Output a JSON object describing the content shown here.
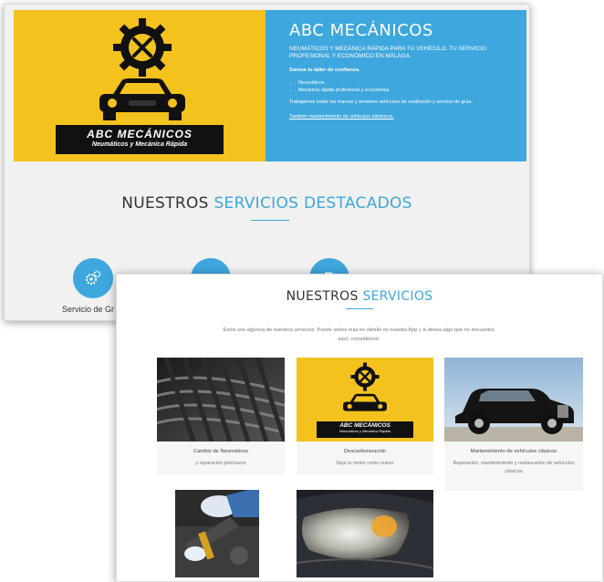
{
  "hero": {
    "logo_name": "ABC MECÁNICOS",
    "logo_tagline": "Neumáticos y Mecánica Rápida",
    "title": "ABC MECÁNICOS",
    "subtitle": "NEUMÁTICOS Y MECÁNICA RÁPIDA PARA TU VEHÍCULO. TU SERVICIO PROFESIONAL Y ECONÓMICO EN MÁLAGA.",
    "bold_line": "Somos tu taller de confianza.",
    "bullets": [
      "Neumáticos",
      "Mecánica rápida profesional y económica"
    ],
    "paragraph": "Trabajamos todas las marcas y tenemos vehículos de sustitución y servicio de grúa.",
    "link": "También mantenimiento de vehículos eléctricos."
  },
  "featured": {
    "title_dark": "NUESTROS",
    "title_blue": "SERVICIOS DESTACADOS",
    "first_label": "Servicio de Gr"
  },
  "services": {
    "title_dark": "NUESTROS",
    "title_blue": "SERVICIOS",
    "intro": "Estos son algunos de nuestros servicios. Puede verlos más en detalle en nuestra App y si desea algo que no encuentra aquí, consúltenos!",
    "cards": [
      {
        "title": "Cambio de Neumáticos",
        "desc": "y reparación pinchazos"
      },
      {
        "title": "Descarbonización",
        "desc": "Deja tu motor como nuevo"
      },
      {
        "title": "Mantenimiento de vehículos clásicos",
        "desc": "Reparación, mantenimiento y restauración de vehículos clásicos"
      }
    ]
  },
  "colors": {
    "accent": "#3ea7dd",
    "brand_yellow": "#f3c21d"
  },
  "icons": [
    "gear-wrench-icon",
    "car-icon",
    "gears-icon",
    "car-front-icon",
    "service-history-icon"
  ]
}
